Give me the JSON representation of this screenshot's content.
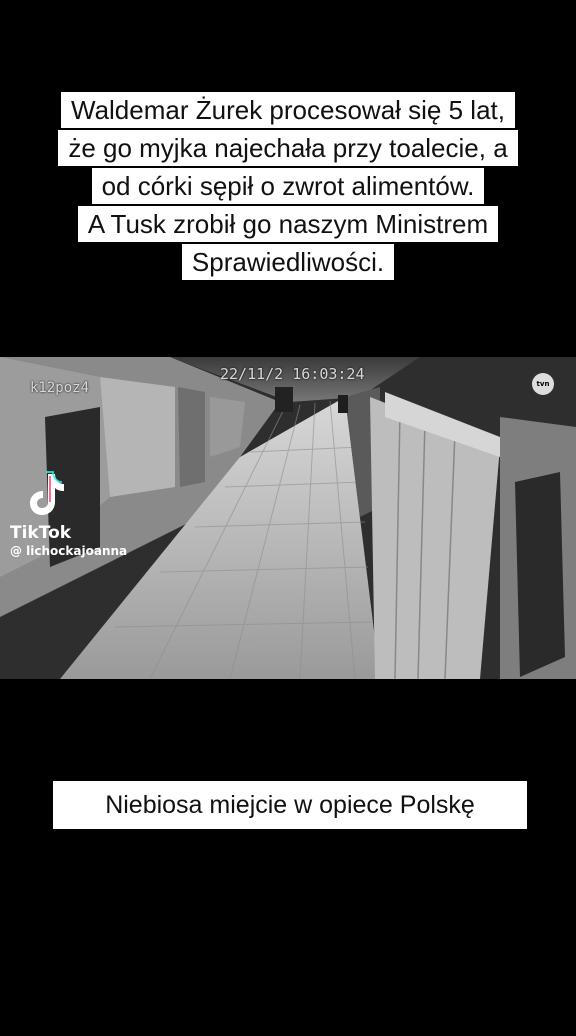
{
  "caption_top": {
    "lines": [
      "Waldemar Żurek procesował się 5 lat,",
      "że go myjka najechała przy toalecie, a",
      "od córki sępił o zwrot alimentów.",
      "A Tusk zrobił go naszym Ministrem",
      "Sprawiedliwości."
    ]
  },
  "video": {
    "camera_id": "k12poz4",
    "timestamp": "22/11/2   16:03:24",
    "broadcaster_logo": "tvn"
  },
  "watermark": {
    "brand": "TikTok",
    "username": "@ lichockajoanna",
    "icon": "tiktok-note-icon"
  },
  "caption_bottom": {
    "text": "Niebiosa miejcie w opiece Polskę"
  }
}
